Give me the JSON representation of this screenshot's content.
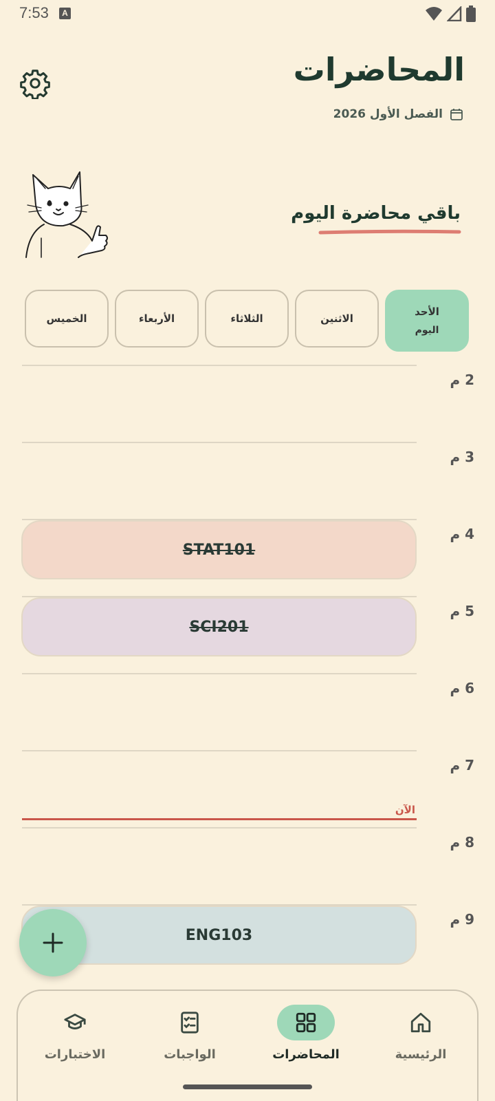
{
  "status_bar": {
    "time": "7:53",
    "badge": "A"
  },
  "header": {
    "title": "المحاضرات",
    "term": "الفصل الأول 2026"
  },
  "hero": {
    "message": "باقي محاضرة اليوم"
  },
  "days": [
    {
      "label": "الأحد",
      "sub": "اليوم",
      "active": true
    },
    {
      "label": "الاثنين"
    },
    {
      "label": "الثلاثاء"
    },
    {
      "label": "الأربعاء"
    },
    {
      "label": "الخميس"
    }
  ],
  "hours": [
    "2 م",
    "3 م",
    "4 م",
    "5 م",
    "6 م",
    "7 م",
    "8 م",
    "9 م"
  ],
  "events": [
    {
      "code": "STAT101",
      "hour": "4 م",
      "color": "#f3d8c9",
      "done": true
    },
    {
      "code": "SCI201",
      "hour": "5 م",
      "color": "#e5d8e0",
      "done": true
    },
    {
      "code": "ENG103",
      "hour": "9 م",
      "color": "#d3e0df",
      "done": false
    }
  ],
  "now_label": "الآن",
  "nav": [
    {
      "label": "الرئيسية",
      "icon": "home-icon"
    },
    {
      "label": "المحاضرات",
      "icon": "grid-icon",
      "active": true
    },
    {
      "label": "الواجبات",
      "icon": "checklist-icon"
    },
    {
      "label": "الاختبارات",
      "icon": "graduation-cap-icon"
    }
  ],
  "colors": {
    "background": "#faf1dd",
    "accent": "#9ed8b8",
    "now": "#c9564a"
  }
}
